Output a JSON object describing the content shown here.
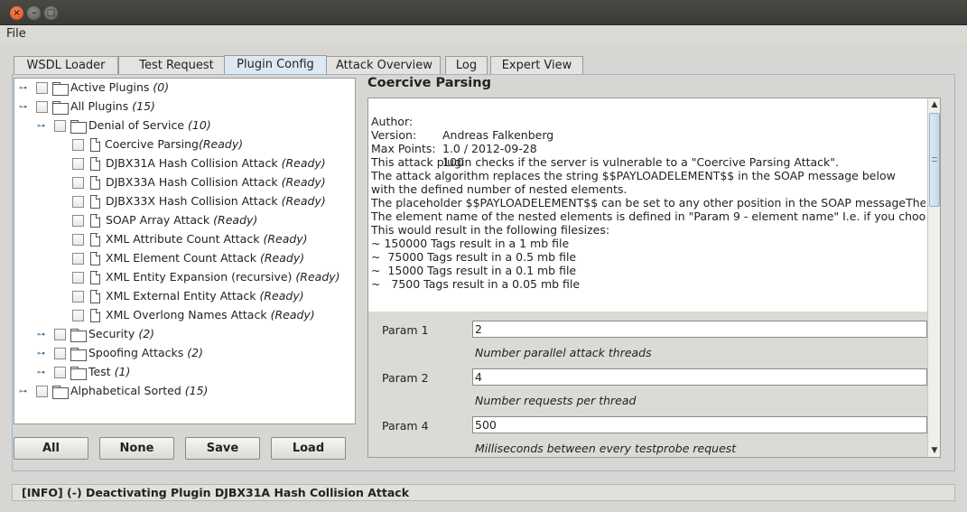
{
  "window": {
    "close_glyph": "×",
    "min_glyph": "–",
    "max_glyph": "□"
  },
  "menu": {
    "file": "File"
  },
  "tabs": [
    "WSDL Loader",
    "Test Request",
    "Plugin Config",
    "Attack Overview",
    "Log",
    "Expert View"
  ],
  "active_tab": "Plugin Config",
  "tree": [
    {
      "label": "Active Plugins",
      "status": "(0)"
    },
    {
      "label": "All Plugins",
      "status": "(15)"
    },
    {
      "label": "Denial of Service",
      "status": "(10)"
    },
    {
      "label": "Coercive Parsing",
      "status": "(Ready)"
    },
    {
      "label": "DJBX31A Hash Collision Attack",
      "status": "(Ready)"
    },
    {
      "label": "DJBX33A Hash Collision Attack",
      "status": "(Ready)"
    },
    {
      "label": "DJBX33X Hash Collision Attack",
      "status": "(Ready)"
    },
    {
      "label": "SOAP Array Attack",
      "status": "(Ready)"
    },
    {
      "label": "XML Attribute Count Attack",
      "status": "(Ready)"
    },
    {
      "label": "XML Element Count Attack",
      "status": "(Ready)"
    },
    {
      "label": "XML Entity Expansion (recursive)",
      "status": "(Ready)"
    },
    {
      "label": "XML External Entity Attack",
      "status": "(Ready)"
    },
    {
      "label": "XML Overlong Names Attack",
      "status": "(Ready)"
    },
    {
      "label": "Security",
      "status": "(2)"
    },
    {
      "label": "Spoofing Attacks",
      "status": "(2)"
    },
    {
      "label": "Test",
      "status": "(1)"
    },
    {
      "label": "Alphabetical Sorted",
      "status": "(15)"
    }
  ],
  "buttons": {
    "all": "All",
    "none": "None",
    "save": "Save",
    "load": "Load"
  },
  "detail": {
    "title": "Coercive Parsing",
    "author_key": "Author:",
    "author": "Andreas Falkenberg",
    "version_key": "Version:",
    "version": "1.0 / 2012-09-28",
    "maxpoints_key": "Max Points:",
    "maxpoints": "100",
    "description": [
      "This attack plugin checks if the server is vulnerable to a \"Coercive Parsing Attack\".",
      "The attack algorithm replaces the string $$PAYLOADELEMENT$$ in the SOAP message below",
      "with the defined number of nested elements.",
      "The placeholder $$PAYLOADELEMENT$$ can be set to any other position in the SOAP messageThe",
      "The element name of the nested elements is defined in \"Param 9 - element name\" I.e. if you choos",
      "This would result in the following filesizes:",
      "~ 150000 Tags result in a 1 mb file",
      "~  75000 Tags result in a 0.5 mb file",
      "~  15000 Tags result in a 0.1 mb file",
      "~   7500 Tags result in a 0.05 mb file"
    ],
    "params": [
      {
        "name": "Param 1",
        "value": "2",
        "help": "Number parallel attack threads"
      },
      {
        "name": "Param 2",
        "value": "4",
        "help": "Number requests per thread"
      },
      {
        "name": "Param 4",
        "value": "500",
        "help": "Milliseconds between every testprobe request"
      }
    ]
  },
  "status": "[INFO] (-) Deactivating Plugin DJBX31A Hash Collision Attack",
  "colors": {
    "accent": "#9bb7d0",
    "selection": "#d3e2f2",
    "titlebar": "#3b3a36"
  }
}
